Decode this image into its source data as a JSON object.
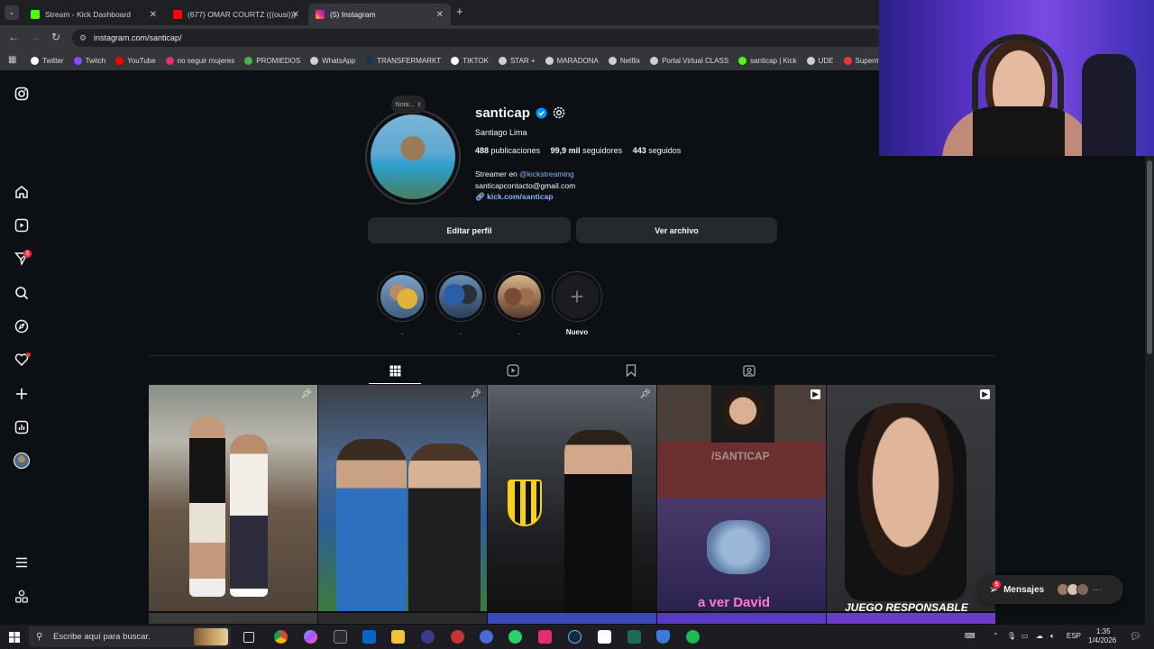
{
  "browser": {
    "tabs": [
      {
        "label": "Stream - Kick Dashboard",
        "color": "#53fc18"
      },
      {
        "label": "(677) OMAR COURTZ (((ousi)))",
        "color": "#ff0000"
      },
      {
        "label": "(5) Instagram",
        "color": "#e1306c"
      }
    ],
    "new_tab": "+",
    "url": "instagram.com/santicap/",
    "bookmarks": [
      {
        "label": "Twitter",
        "color": "#ffffff"
      },
      {
        "label": "Twitch",
        "color": "#9146ff"
      },
      {
        "label": "YouTube",
        "color": "#ff0000"
      },
      {
        "label": "no seguir mujeres",
        "color": "#e1306c"
      },
      {
        "label": "PROMIEDOS",
        "color": "#4caf50"
      },
      {
        "label": "WhatsApp",
        "color": "#cfcfcf"
      },
      {
        "label": "TRANSFERMARKT",
        "color": "#1a3151"
      },
      {
        "label": "TIKTOK",
        "color": "#ffffff"
      },
      {
        "label": "STAR +",
        "color": "#cfcfcf"
      },
      {
        "label": "MARADONA",
        "color": "#cfcfcf"
      },
      {
        "label": "Netflix",
        "color": "#cfcfcf"
      },
      {
        "label": "Portal Virtual CLASS",
        "color": "#cfcfcf"
      },
      {
        "label": "santicap | Kick",
        "color": "#53fc18"
      },
      {
        "label": "UDE",
        "color": "#cfcfcf"
      },
      {
        "label": "Superm",
        "color": "#e53935"
      }
    ]
  },
  "sidebar": {
    "notifications_badge": "5"
  },
  "profile": {
    "username": "santicap",
    "full_name": "Santiago Lima",
    "note_label": "Nota...",
    "posts_count": "488",
    "posts_label": "publicaciones",
    "followers_count": "99,9 mil",
    "followers_label": "seguidores",
    "following_count": "443",
    "following_label": "seguidos",
    "bio_prefix": "Streamer en ",
    "bio_mention": "@kickstreaming",
    "bio_email": "santicapcontacto@gmail.com",
    "link": "kick.com/santicap",
    "edit_button": "Editar perfil",
    "archive_button": "Ver archivo"
  },
  "highlights": [
    {
      "label": "."
    },
    {
      "label": "."
    },
    {
      "label": "."
    },
    {
      "label": "Nuevo"
    }
  ],
  "posts": [
    {
      "overlay_text": ""
    },
    {
      "overlay_text": ""
    },
    {
      "overlay_text": ""
    },
    {
      "overlay_text": "a ver David",
      "watermark": "/SANTICAP"
    },
    {
      "overlay_text": "JUEGO RESPONSABLE"
    }
  ],
  "messages": {
    "label": "Mensajes",
    "badge": "5",
    "more": "···"
  },
  "taskbar": {
    "search_placeholder": "Escribe aquí para buscar.",
    "lang": "ESP",
    "time": "1:35",
    "date": "1/4/2026"
  }
}
